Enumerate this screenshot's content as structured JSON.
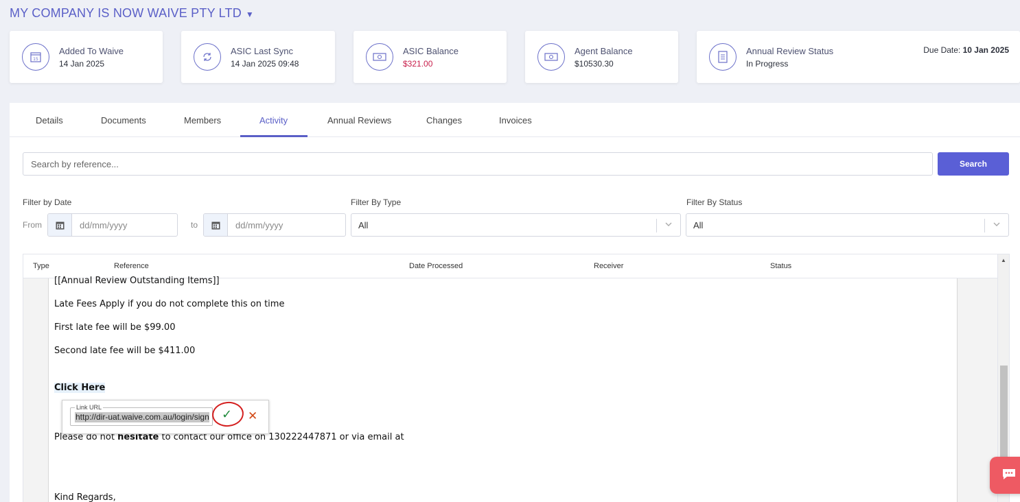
{
  "company": {
    "title": "MY COMPANY IS NOW WAIVE PTY LTD"
  },
  "cards": [
    {
      "label": "Added To Waive",
      "value": "14 Jan 2025"
    },
    {
      "label": "ASIC Last Sync",
      "value": "14 Jan 2025 09:48"
    },
    {
      "label": "ASIC Balance",
      "value": "$321.00"
    },
    {
      "label": "Agent Balance",
      "value": "$10530.30"
    },
    {
      "label": "Annual Review Status",
      "value": "In Progress",
      "due_label": "Due Date:",
      "due_value": "10 Jan 2025"
    }
  ],
  "tabs": [
    "Details",
    "Documents",
    "Members",
    "Activity",
    "Annual Reviews",
    "Changes",
    "Invoices"
  ],
  "active_tab": "Activity",
  "search": {
    "placeholder": "Search by reference...",
    "button": "Search"
  },
  "filters": {
    "date_label": "Filter by Date",
    "from_label": "From",
    "to_label": "to",
    "date_placeholder": "dd/mm/yyyy",
    "type_label": "Filter By Type",
    "type_value": "All",
    "status_label": "Filter By Status",
    "status_value": "All"
  },
  "table": {
    "headers": [
      "Type",
      "Reference",
      "Date Processed",
      "Receiver",
      "Status"
    ]
  },
  "editor": {
    "lines": [
      "[[Annual Review Outstanding Items]]",
      "Late Fees Apply if you do not complete this on time",
      "First late fee will be $99.00",
      "Second late fee will be $411.00",
      "Click Here",
      "Please do not ",
      "hesitate",
      " to contact our office on 130222447871 or via email at",
      "Kind Regards,"
    ]
  },
  "link_popup": {
    "legend": "Link URL",
    "url": "http://dir-uat.waive.com.au/login/signin"
  },
  "colors": {
    "accent": "#5a5fc7",
    "danger": "#c81e4b",
    "confirm": "#1f8a3b",
    "chat": "#ee5a63"
  }
}
